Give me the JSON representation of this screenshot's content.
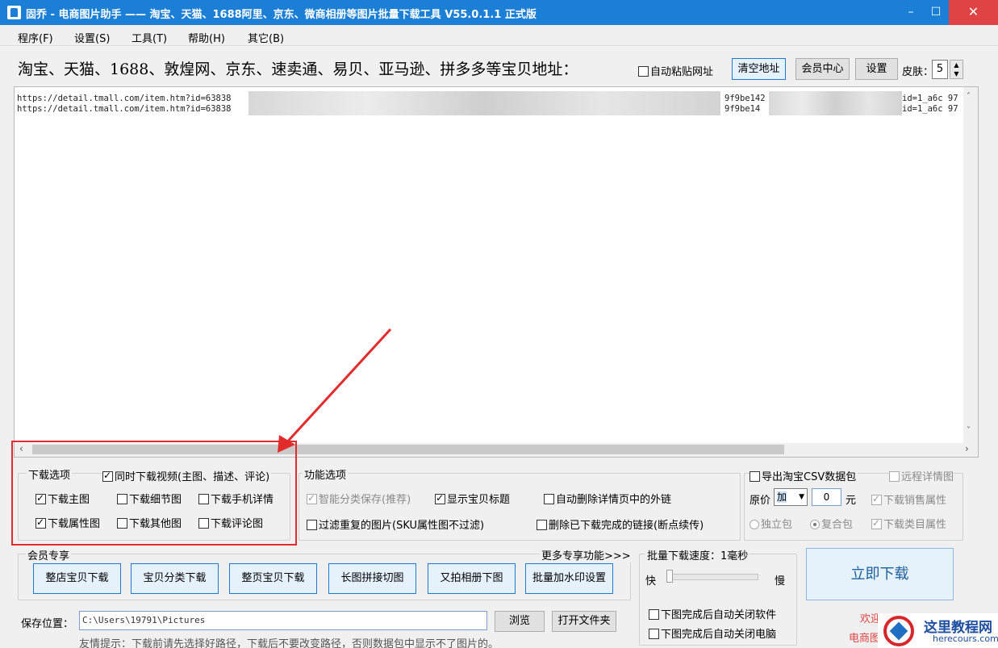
{
  "window": {
    "title": "固乔 - 电商图片助手 —— 淘宝、天猫、1688阿里、京东、微商相册等图片批量下载工具 V55.0.1.1 正式版",
    "minimize": "–",
    "maximize": "☐",
    "close": "✕"
  },
  "menu": [
    "程序(F)",
    "设置(S)",
    "工具(T)",
    "帮助(H)",
    "其它(B)"
  ],
  "header": {
    "label": "淘宝、天猫、1688、敦煌网、京东、速卖通、易贝、亚马逊、拼多多等宝贝地址：",
    "auto_paste": "自动粘贴网址",
    "clear_btn": "清空地址",
    "member_btn": "会员中心",
    "settings_btn": "设置",
    "skin_label": "皮肤：",
    "skin_value": "5"
  },
  "urls": [
    {
      "prefix": "https://detail.tmall.com/item.htm?id=63838",
      "mid": "9f9be142",
      "tail": "id=1_a6c 97"
    },
    {
      "prefix": "https://detail.tmall.com/item.htm?id=63838",
      "mid": "9f9be14",
      "tail": "id=1_a6c 97"
    }
  ],
  "download_options": {
    "title": "下载选项",
    "video": {
      "label": "同时下载视频(主图、描述、评论)",
      "checked": true
    },
    "items": [
      {
        "label": "下载主图",
        "checked": true
      },
      {
        "label": "下载细节图",
        "checked": false
      },
      {
        "label": "下载手机详情",
        "checked": false
      },
      {
        "label": "下载属性图",
        "checked": true
      },
      {
        "label": "下载其他图",
        "checked": false
      },
      {
        "label": "下载评论图",
        "checked": false
      }
    ]
  },
  "function_options": {
    "title": "功能选项",
    "smart_save": "智能分类保存(推荐)",
    "show_title": "显示宝贝标题",
    "auto_delete_links": "自动删除详情页中的外链",
    "filter_dup": "过滤重复的图片(SKU属性图不过滤)",
    "delete_done": "删除已下载完成的链接(断点续传)"
  },
  "csv_options": {
    "export_csv": "导出淘宝CSV数据包",
    "remote_detail": "远程详情图",
    "price_label": "原价",
    "price_op": "加",
    "price_value": "0",
    "price_unit": "元",
    "sales_attr": "下载销售属性",
    "standalone": "独立包",
    "composite": "复合包",
    "category_attr": "下载类目属性"
  },
  "member": {
    "title": "会员专享",
    "more": "更多专享功能>>>",
    "buttons": [
      "整店宝贝下载",
      "宝贝分类下载",
      "整页宝贝下载",
      "长图拼接切图",
      "又拍相册下图",
      "批量加水印设置"
    ]
  },
  "speed": {
    "title": "批量下载速度：1毫秒",
    "fast": "快",
    "slow": "慢",
    "level": 0
  },
  "after": {
    "close_app": "下图完成后自动关闭软件",
    "shutdown": "下图完成后自动关闭电脑"
  },
  "download_now": "立即下载",
  "save": {
    "label": "保存位置：",
    "path": "C:\\Users\\19791\\Pictures",
    "browse": "浏览",
    "open_folder": "打开文件夹",
    "tip": "友情提示：下载前请先选择好路径，下载后不要改变路径，否则数据包中显示不了图片的。"
  },
  "welcome": {
    "line1": "欢迎使用",
    "line2": "电商图"
  },
  "watermark": {
    "cn": "这里教程网",
    "en": "herecours.com"
  },
  "colors": {
    "titlebar": "#1b7fd6",
    "close": "#e04343",
    "annotation": "#e42b2b"
  }
}
